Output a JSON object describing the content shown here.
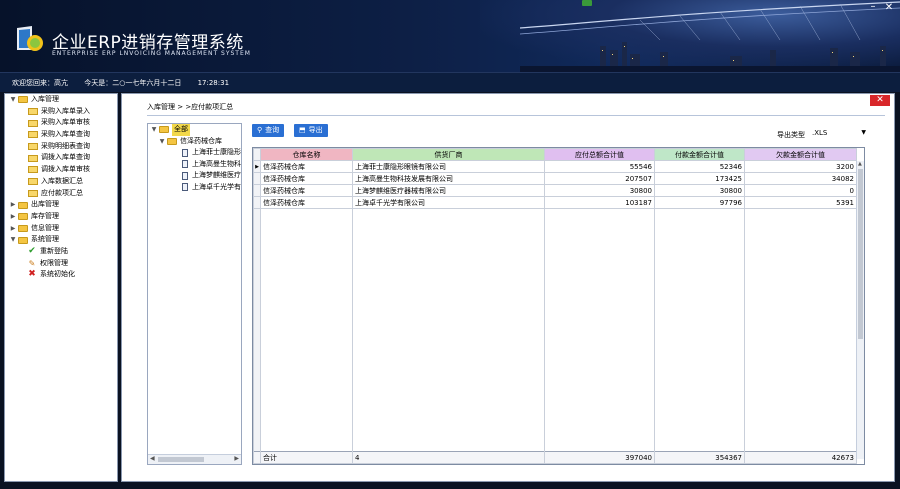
{
  "header": {
    "app_title": "企业ERP进销存管理系统",
    "app_subtitle": "ENTERPRISE ERP LNVOICING  MANAGEMENT SYSTEM"
  },
  "status": {
    "welcome": "欢迎您回来：高亢",
    "date": "今天是：二○一七年六月十二日",
    "time": "17:28:31"
  },
  "nav": [
    {
      "label": "入库管理",
      "expanded": true,
      "children": [
        "采购入库单录入",
        "采购入库单审核",
        "采购入库单查询",
        "采购明细表查询",
        "调拨入库单查询",
        "调拨入库单审核",
        "入库数据汇总",
        "应付款项汇总"
      ]
    },
    {
      "label": "出库管理",
      "expanded": false
    },
    {
      "label": "库存管理",
      "expanded": false
    },
    {
      "label": "信息管理",
      "expanded": false
    },
    {
      "label": "系统管理",
      "expanded": true,
      "children": [
        "重新登陆",
        "权限管理",
        "系统初始化"
      ]
    }
  ],
  "breadcrumb": "入库管理 > >应付款项汇总",
  "tree": {
    "root": "全部",
    "warehouse": "信泽药械仓库",
    "suppliers": [
      "上海菲士康隐形",
      "上海高曼生物科",
      "上海梦麒维医疗",
      "上海卓千光学有"
    ]
  },
  "toolbar": {
    "query_label": "查询",
    "export_label": "导出",
    "export_type_label": "导出类型",
    "export_type_value": ".XLS"
  },
  "grid": {
    "columns": [
      "仓库名称",
      "供货厂商",
      "应付总额合计值",
      "付款金额合计值",
      "欠款金额合计值"
    ],
    "rows": [
      [
        "信泽药械仓库",
        "上海菲士康隐形眼镜有限公司",
        "55546",
        "52346",
        "3200"
      ],
      [
        "信泽药械仓库",
        "上海高曼生物科技发展有限公司",
        "207507",
        "173425",
        "34082"
      ],
      [
        "信泽药械仓库",
        "上海梦麒维医疗器械有限公司",
        "30800",
        "30800",
        "0"
      ],
      [
        "信泽药械仓库",
        "上海卓千光学有限公司",
        "103187",
        "97796",
        "5391"
      ]
    ],
    "totals": [
      "合计",
      "4",
      "397040",
      "354367",
      "42673"
    ]
  },
  "colors": {
    "header_bg": "#0d1f45",
    "button_blue": "#2a6fd3",
    "close_red": "#d8262a",
    "selected_yellow": "#f2d84a"
  }
}
